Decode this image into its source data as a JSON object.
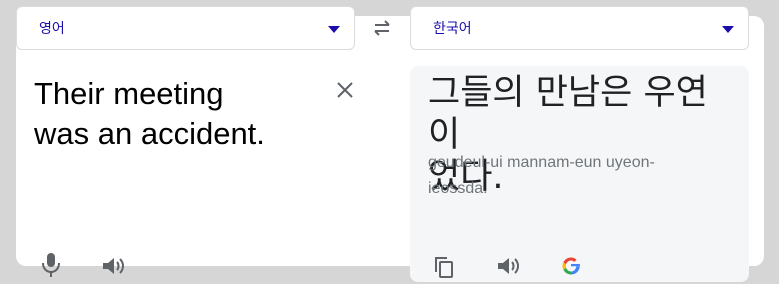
{
  "source": {
    "language": "영어",
    "text_line1": "Their meeting",
    "text_line2": "was an accident."
  },
  "target": {
    "language": "한국어",
    "text_line1": "그들의 만남은 우연이",
    "text_line2": "었다.",
    "romanization_line1": "geudeul-ui mannam-eun uyeon-",
    "romanization_line2": "ieossda."
  },
  "icons": {
    "swap": "swap-arrows-icon",
    "clear": "close-icon",
    "mic": "microphone-icon",
    "source_listen": "speaker-icon",
    "copy": "copy-icon",
    "target_listen": "speaker-icon",
    "google": "google-logo-icon"
  },
  "colors": {
    "language_link": "#1a0dab",
    "icon": "#5f6368",
    "background": "#d6d6d6",
    "target_panel": "#f5f6f8"
  }
}
